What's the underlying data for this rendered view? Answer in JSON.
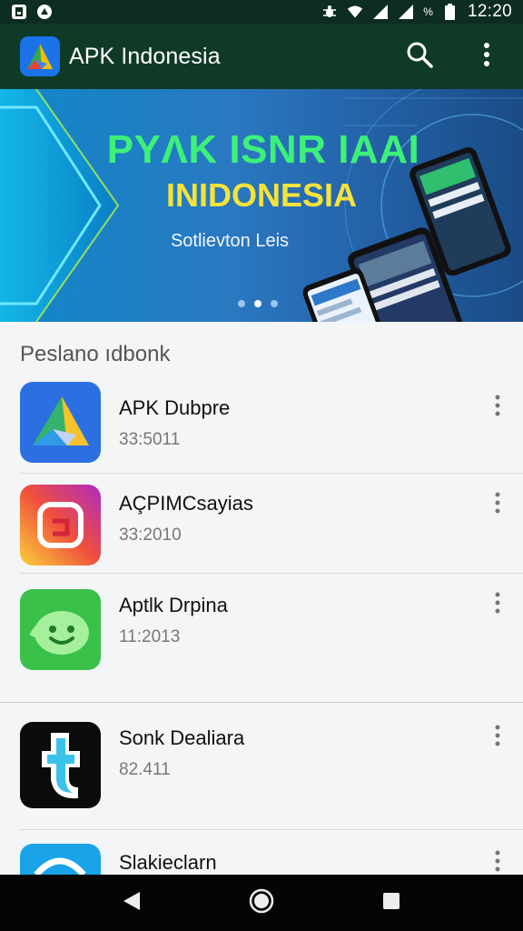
{
  "status_bar": {
    "time": "12:20",
    "battery_text": "%",
    "left_icons": [
      "notification-square-icon",
      "notification-circle-icon"
    ],
    "right_icons": [
      "bug-icon",
      "wifi-icon",
      "signal-icon",
      "signal-icon",
      "battery-icon"
    ]
  },
  "app_bar": {
    "title": "APK Indonesia",
    "logo_icon": "triangle-play-logo-icon",
    "actions": [
      "search-icon",
      "more-vert-icon"
    ]
  },
  "banner": {
    "title": "PYΛK ISNR IAAI",
    "subtitle": "INIDONESIA",
    "tagline": "Sotlievton Leis",
    "page_count": 3,
    "active_page": 2
  },
  "section": {
    "title": "Peslano ıdbonk"
  },
  "apps": [
    {
      "name": "APK Dubpre",
      "meta": "33:5011",
      "icon": "triangle-arrow-icon"
    },
    {
      "name": "AÇPIMCsayias",
      "meta": "33:2010",
      "icon": "instagram-like-icon"
    },
    {
      "name": "Aptlk Drpina",
      "meta": "11:2013",
      "icon": "android-face-icon"
    },
    {
      "name": "Sonk Dealiara",
      "meta": "82.411",
      "icon": "puzzle-t-icon"
    },
    {
      "name": "Slakieclarn",
      "meta": "",
      "icon": "blue-dome-icon"
    }
  ],
  "nav_bar": {
    "buttons": [
      "back-icon",
      "home-icon",
      "recents-icon"
    ]
  },
  "colors": {
    "status_bar": "#0c2d1f",
    "app_bar": "#103a28",
    "banner_title": "#3df07a",
    "banner_subtitle": "#f5e23a"
  }
}
